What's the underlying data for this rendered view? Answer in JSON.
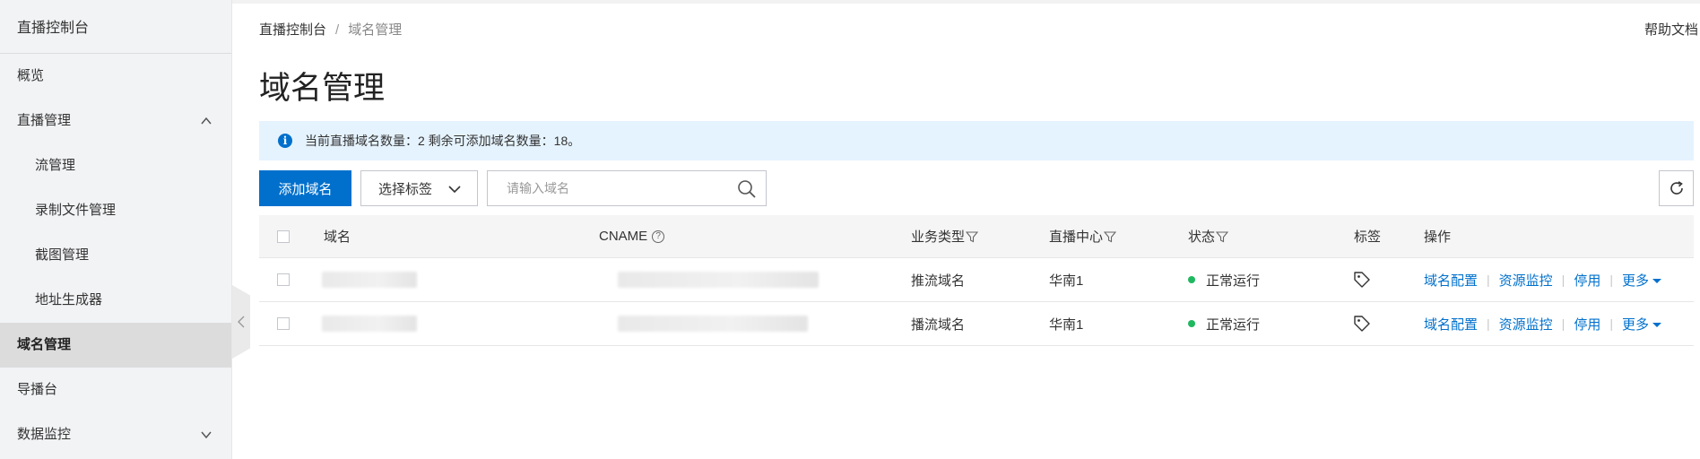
{
  "sidebar": {
    "title": "直播控制台",
    "items": [
      {
        "label": "概览"
      },
      {
        "label": "直播管理"
      },
      {
        "label": "流管理"
      },
      {
        "label": "录制文件管理"
      },
      {
        "label": "截图管理"
      },
      {
        "label": "地址生成器"
      },
      {
        "label": "域名管理"
      },
      {
        "label": "导播台"
      },
      {
        "label": "数据监控"
      }
    ]
  },
  "header": {
    "breadcrumb": [
      "直播控制台",
      "域名管理"
    ],
    "breadcrumb_sep": "/",
    "help": "帮助文档",
    "title": "域名管理"
  },
  "notice": {
    "icon": "info-icon",
    "text": "当前直播域名数量：2 剩余可添加域名数量：18。"
  },
  "toolbar": {
    "add_label": "添加域名",
    "tag_select_label": "选择标签",
    "search_placeholder": "请输入域名",
    "search_value": ""
  },
  "table": {
    "columns": {
      "domain": "域名",
      "cname": "CNAME",
      "type": "业务类型",
      "center": "直播中心",
      "status": "状态",
      "tag": "标签",
      "ops": "操作"
    },
    "rows": [
      {
        "type": "推流域名",
        "center": "华南1",
        "status": "正常运行"
      },
      {
        "type": "播流域名",
        "center": "华南1",
        "status": "正常运行"
      }
    ],
    "actions": {
      "config": "域名配置",
      "monitor": "资源监控",
      "disable": "停用",
      "more": "更多"
    },
    "action_sep": "|"
  },
  "colors": {
    "primary": "#0070cc",
    "accent": "#ff6a00",
    "status_ok": "#1fb860"
  }
}
